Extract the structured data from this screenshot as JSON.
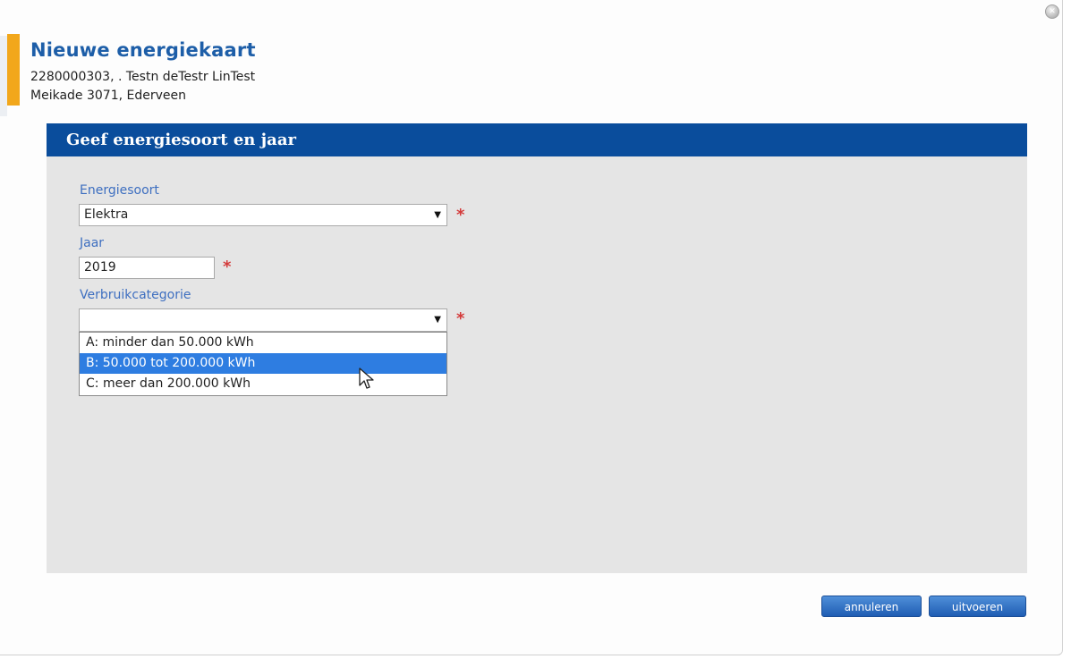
{
  "header": {
    "title": "Nieuwe energiekaart",
    "line1": "2280000303, . Testn deTestr LinTest",
    "line2": "Meikade 3071, Ederveen"
  },
  "panel": {
    "title": "Geef energiesoort en jaar"
  },
  "form": {
    "energiesoort_label": "Energiesoort",
    "energiesoort_value": "Elektra",
    "jaar_label": "Jaar",
    "jaar_value": "2019",
    "verbruik_label": "Verbruikcategorie",
    "verbruik_value": "",
    "required_mark": "*",
    "verbruik_options": [
      "A: minder dan 50.000 kWh",
      "B: 50.000 tot 200.000 kWh",
      "C: meer dan 200.000 kWh"
    ],
    "highlighted_option_index": 1
  },
  "buttons": {
    "cancel": "annuleren",
    "submit": "uitvoeren"
  },
  "icons": {
    "close": "close-icon",
    "dropdown": "chevron-down-icon",
    "cursor": "mouse-pointer-icon"
  },
  "colors": {
    "accent": "#f2a71b",
    "panel_header": "#0a4d9c",
    "label": "#3e6fc0",
    "required": "#d43a3a",
    "selection": "#2e7de1"
  }
}
